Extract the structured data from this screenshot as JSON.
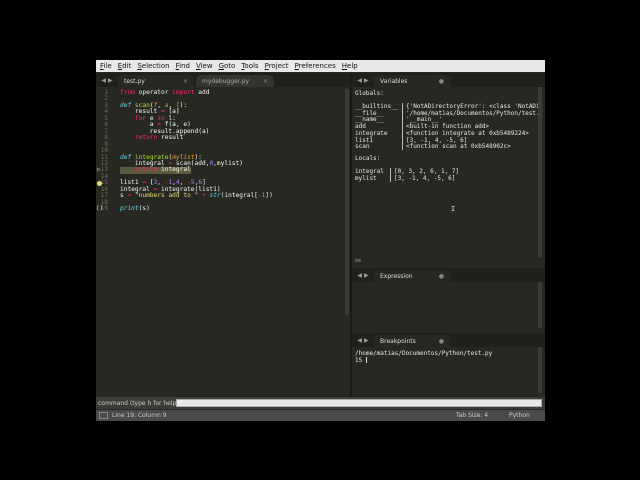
{
  "menu": [
    "File",
    "Edit",
    "Selection",
    "Find",
    "View",
    "Goto",
    "Tools",
    "Project",
    "Preferences",
    "Help"
  ],
  "left_tabs": [
    {
      "label": "test.py",
      "close": "×"
    },
    {
      "label": "mydebugger.py",
      "close": "×"
    }
  ],
  "code_lines": [
    {
      "n": "1",
      "html": "<span class='k'>from</span> operator <span class='k'>import</span> add"
    },
    {
      "n": "2",
      "html": ""
    },
    {
      "n": "3",
      "html": "<span class='d'>def</span> <span class='f'>scan</span>(<span class='p'>f</span>, <span class='p'>a</span>, <span class='p'>l</span>):"
    },
    {
      "n": "4",
      "html": "    result <span class='k'>=</span> [a]"
    },
    {
      "n": "5",
      "html": "    <span class='k'>for</span> e <span class='k'>in</span> l:"
    },
    {
      "n": "6",
      "html": "        a <span class='k'>=</span> f(a, e)"
    },
    {
      "n": "7",
      "html": "        result.append(a)"
    },
    {
      "n": "8",
      "html": "    <span class='k'>return</span> result"
    },
    {
      "n": "9",
      "html": ""
    },
    {
      "n": "10",
      "html": ""
    },
    {
      "n": "11",
      "html": "<span class='d'>def</span> <span class='f'>integrate</span>(<span class='p'>mylist</span>):"
    },
    {
      "n": "12",
      "html": "    integral <span class='k'>=</span> scan(add,<span class='n'>0</span>,mylist)"
    },
    {
      "n": "13",
      "html": "    <span class='k'>return</span> integral"
    },
    {
      "n": "14",
      "html": ""
    },
    {
      "n": "15",
      "html": "list1 <span class='k'>=</span> [<span class='n'>3</span>, <span class='k'>-</span><span class='n'>1</span>,<span class='n'>4</span>, <span class='k'>-</span><span class='n'>5</span>,<span class='n'>6</span>]"
    },
    {
      "n": "16",
      "html": "integral <span class='k'>=</span> integrate(list1)"
    },
    {
      "n": "17",
      "html": "s <span class='k'>=</span> <span class='s'>\"numbers add to \"</span> <span class='k'>+</span> <span class='d'>str</span>(integral[<span class='k'>-</span><span class='n'>1</span>])"
    },
    {
      "n": "18",
      "html": ""
    },
    {
      "n": "19",
      "html": "<span class='d'>print</span>(s)"
    }
  ],
  "variables_tab": "Variables",
  "variables": {
    "globals_label": "Globals:",
    "globals": [
      {
        "name": "__builtins__",
        "value": "{'NotADirectoryError': <class 'NotADi"
      },
      {
        "name": "__file__",
        "value": "'/home/matias/Documentos/Python/test.("
      },
      {
        "name": "__name__",
        "value": "'__main__'"
      },
      {
        "name": "add",
        "value": "<built-in function add>"
      },
      {
        "name": "integrate",
        "value": "<function integrate at 0xb5489224>"
      },
      {
        "name": "list1",
        "value": "[3, -1, 4, -5, 6]"
      },
      {
        "name": "scan",
        "value": "<function scan at 0xb548902c>"
      }
    ],
    "locals_label": "Locals:",
    "locals": [
      {
        "name": "integral",
        "value": "[0, 3, 2, 6, 1, 7]"
      },
      {
        "name": "mylist",
        "value": "[3, -1, 4, -5, 6]"
      }
    ]
  },
  "expression_tab": "Expression",
  "breakpoints_tab": "Breakpoints",
  "breakpoints": [
    "/home/matias/Documentos/Python/test.py",
    "15"
  ],
  "command_label": "command (type h for help)",
  "status": {
    "position": "Line 19, Column 9",
    "tab_size": "Tab Size: 4",
    "syntax": "Python"
  },
  "colors": {
    "editor_bg": "#272822",
    "keyword": "#f92672",
    "function": "#a6e22e",
    "number": "#ae81ff",
    "string": "#e6db74",
    "builtin": "#66d9ef",
    "param": "#fd971f"
  }
}
